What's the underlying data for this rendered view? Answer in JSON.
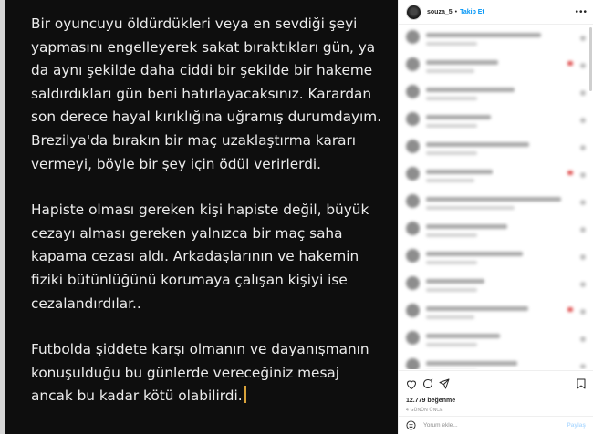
{
  "post": {
    "paragraphs": [
      "Bir oyuncuyu öldürdükleri veya en sevdiği şeyi yapmasını engelleyerek sakat bıraktıkları gün, ya da aynı şekilde daha ciddi bir şekilde bir hakeme saldırdıkları gün beni hatırlayacaksınız. Karardan son derece hayal kırıklığına uğramış durumdayım. Brezilya'da bırakın bir maç uzaklaştırma kararı vermeyi, böyle bir şey için ödül verirlerdi.",
      "Hapiste olması gereken kişi hapiste değil, büyük cezayı alması gereken yalnızca bir maç  saha kapama cezası aldı. Arkadaşlarının ve hakemin fiziki bütünlüğünü korumaya çalışan kişiyi ise cezalandırdılar..",
      "Futbolda şiddete karşı olmanın ve dayanışmanın konuşulduğu bu günlerde vereceğiniz mesaj ancak bu kadar kötü olabilirdi."
    ]
  },
  "header": {
    "username": "souza_5",
    "separator": "•",
    "follow_label": "Takip Et",
    "more_glyph": "•••",
    "avatar_icon": "profile-avatar"
  },
  "comments_count_visible": 13,
  "actions": {
    "like_icon": "heart-icon",
    "comment_icon": "comment-icon",
    "share_icon": "share-icon",
    "save_icon": "bookmark-icon"
  },
  "likes_text": "12.779 beğenme",
  "time_ago": "4 GÜNÜN ÖNCE",
  "composer": {
    "placeholder": "Yorum ekle...",
    "send_label": "Paylaş",
    "emoji_icon": "smiley-icon"
  },
  "colors": {
    "accent": "#0095f6",
    "media_bg": "#0e0e0e",
    "caret": "#d8a23a"
  }
}
